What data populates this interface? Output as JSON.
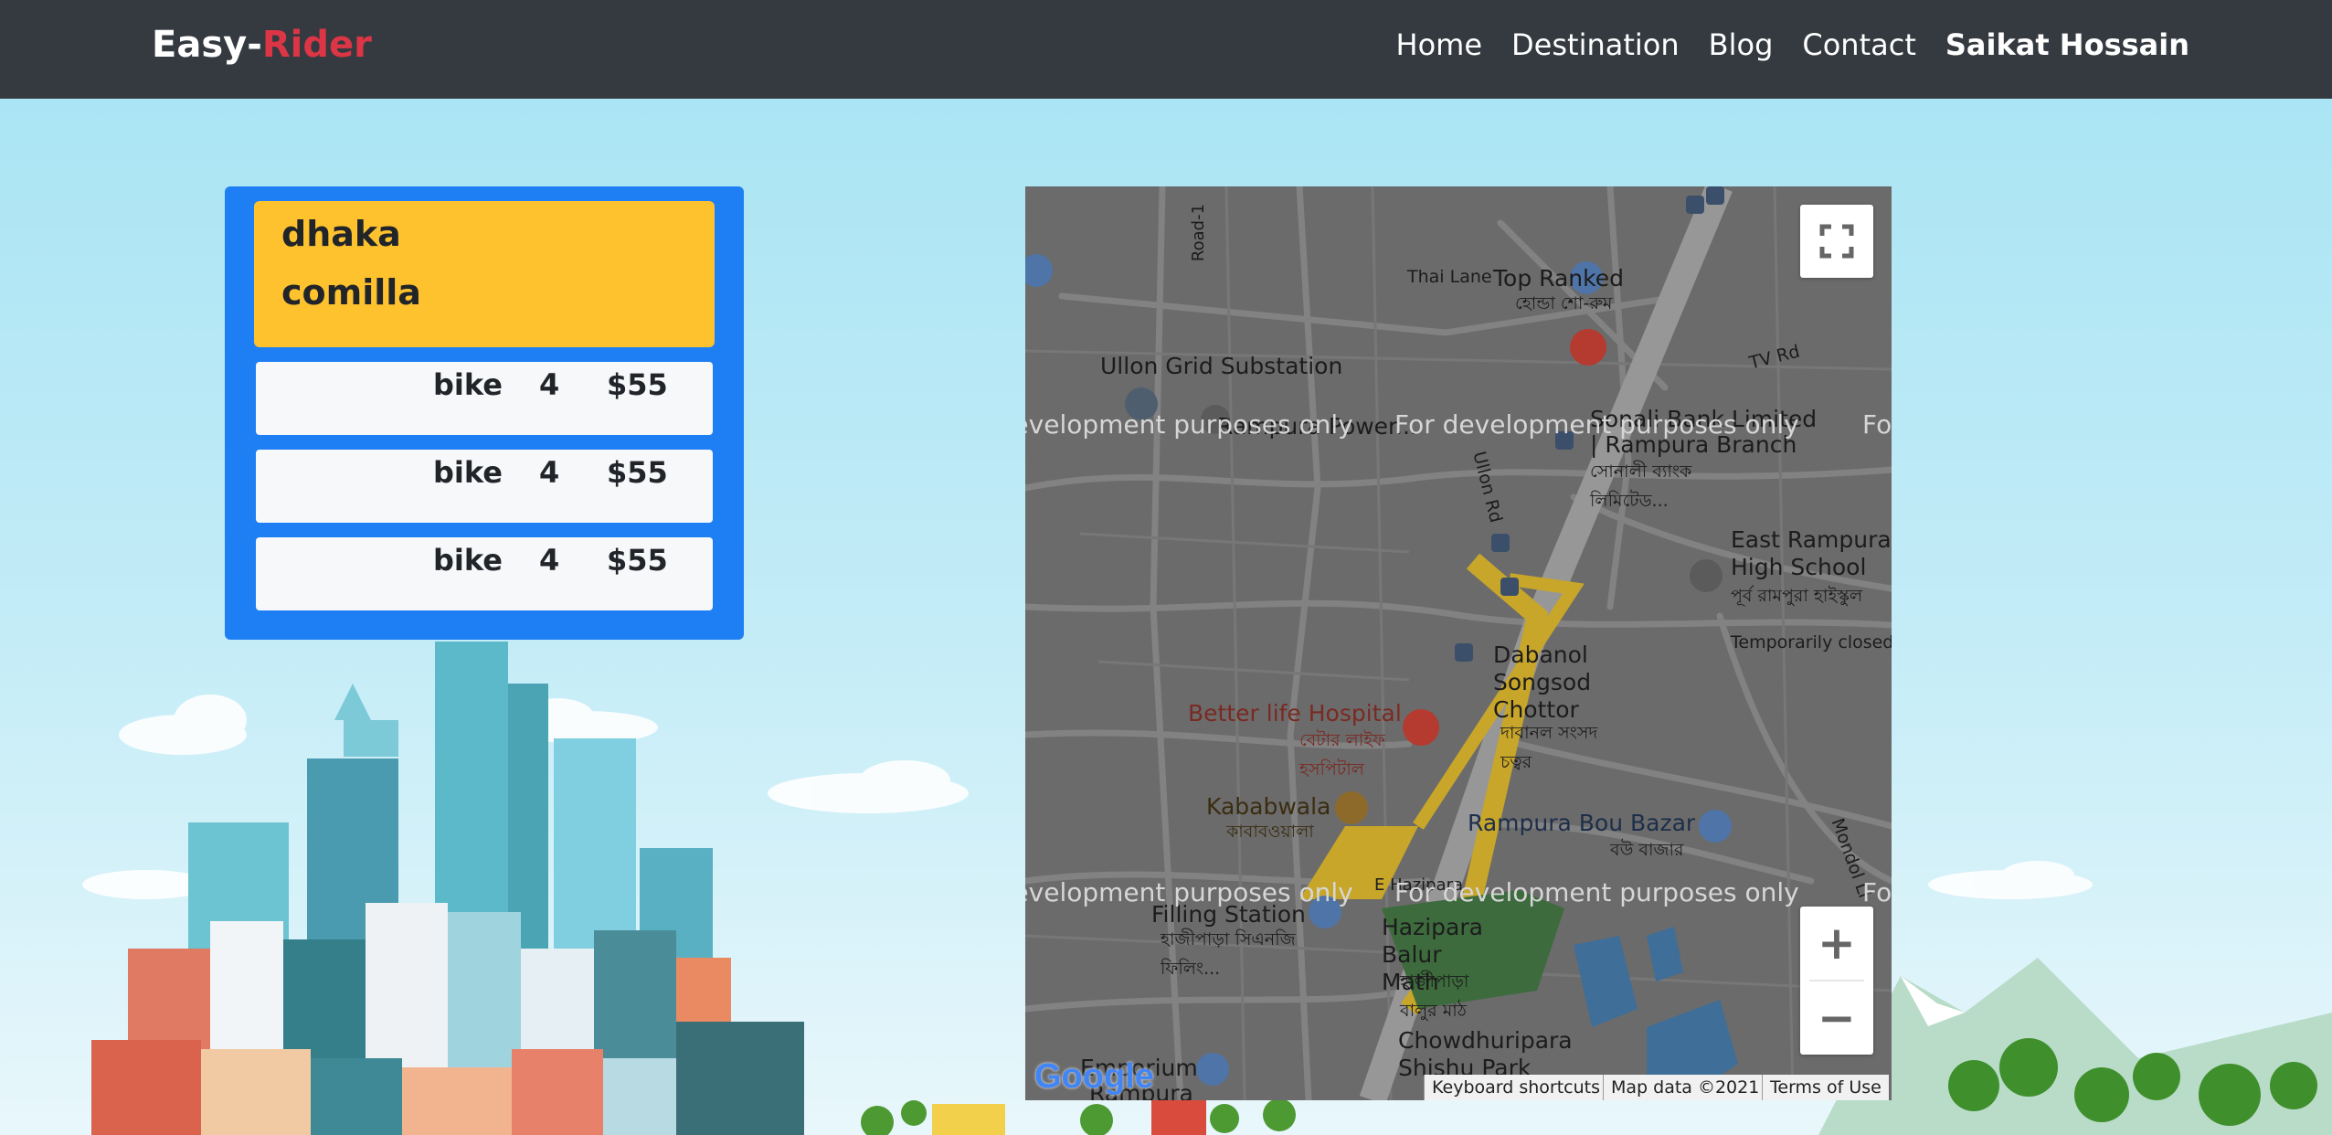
{
  "brand": {
    "prefix": "Easy-",
    "accent": "Rider"
  },
  "nav": {
    "links": [
      "Home",
      "Destination",
      "Blog",
      "Contact"
    ],
    "user": "Saikat Hossain"
  },
  "route": {
    "from": "dhaka",
    "to": "comilla"
  },
  "rides": [
    {
      "vehicle": "bike",
      "seats": "4",
      "price": "$55"
    },
    {
      "vehicle": "bike",
      "seats": "4",
      "price": "$55"
    },
    {
      "vehicle": "bike",
      "seats": "4",
      "price": "$55"
    }
  ],
  "map": {
    "watermark": "For development purposes only",
    "zoom_in": "+",
    "zoom_out": "−",
    "labels": {
      "road1": "Road-1",
      "thai_lane": "Thai Lane",
      "top_ranked": "Top Ranked",
      "top_ranked_bn": "হোন্ডা শো-রুম",
      "ullon": "Ullon Grid Substation",
      "rampura_power": "Rampura Power...",
      "sonali": "Sonali Bank Limited",
      "rampura_branch": "| Rampura Branch",
      "sonali_bn": "সোনালী ব্যাংক লিমিটেড...",
      "tv_rd": "TV Rd",
      "ullon_rd": "Ullon Rd",
      "east_rampura": "East Rampura High School",
      "east_rampura_bn": "পূর্ব রামপুরা হাইস্কুল",
      "temp_closed": "Temporarily closed",
      "dabanol": "Dabanol Songsod Chottor",
      "dabanol_bn": "দাবানল সংসদ চত্বর",
      "better_life": "Better life Hospital",
      "better_life_bn": "বেটার লাইফ হসপিটাল",
      "kababwala": "Kababwala",
      "kababwala_bn": "কাবাবওয়ালা",
      "rampura_bazar": "Rampura Bou Bazar",
      "rampura_bazar_bn": "বউ বাজার",
      "filling": "Filling Station",
      "filling_bn": "হাজীপাড়া সিএনজি ফিলিং...",
      "hazipara": "Hazipara Balur Math",
      "hazipara_bn": "হাজীপাড়া বালুর মাঠ",
      "chowdhuri": "Chowdhuripara Shishu Park",
      "e_hazipara": "E Hazipara",
      "mondol": "Mondol Li",
      "emporium": "Emporium",
      "rampura_bottom": "Rampura"
    },
    "attribution": [
      "Keyboard shortcuts",
      "Map data ©2021",
      "Terms of Use"
    ],
    "logo": "Google",
    "colors": {
      "land": "#6b6b6b",
      "road": "#8a8a8a",
      "highlight": "#c8a62a",
      "park": "#3d6b3d",
      "water": "#3f6e99"
    }
  }
}
